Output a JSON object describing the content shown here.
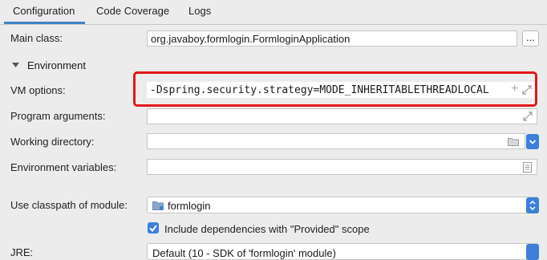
{
  "tabs": [
    "Configuration",
    "Code Coverage",
    "Logs"
  ],
  "main_class": {
    "label": "Main class:",
    "value": "org.javaboy.formlogin.FormloginApplication",
    "browse_label": "..."
  },
  "environment": {
    "label": "Environment"
  },
  "vm_options": {
    "label": "VM options:",
    "value": "-Dspring.security.strategy=MODE_INHERITABLETHREADLOCAL",
    "add_glyph": "+"
  },
  "program_arguments": {
    "label": "Program arguments:",
    "value": ""
  },
  "working_directory": {
    "label": "Working directory:",
    "value": ""
  },
  "environment_variables": {
    "label": "Environment variables:",
    "value": ""
  },
  "classpath": {
    "label": "Use classpath of module:",
    "value": "formlogin"
  },
  "include_dependencies": {
    "label": "Include dependencies with \"Provided\" scope",
    "checked": true
  },
  "jre": {
    "label": "JRE:",
    "value": "Default (10 - SDK of 'formlogin' module)"
  },
  "colors": {
    "accent": "#3d7fd9",
    "highlight_box": "#e0191c"
  }
}
